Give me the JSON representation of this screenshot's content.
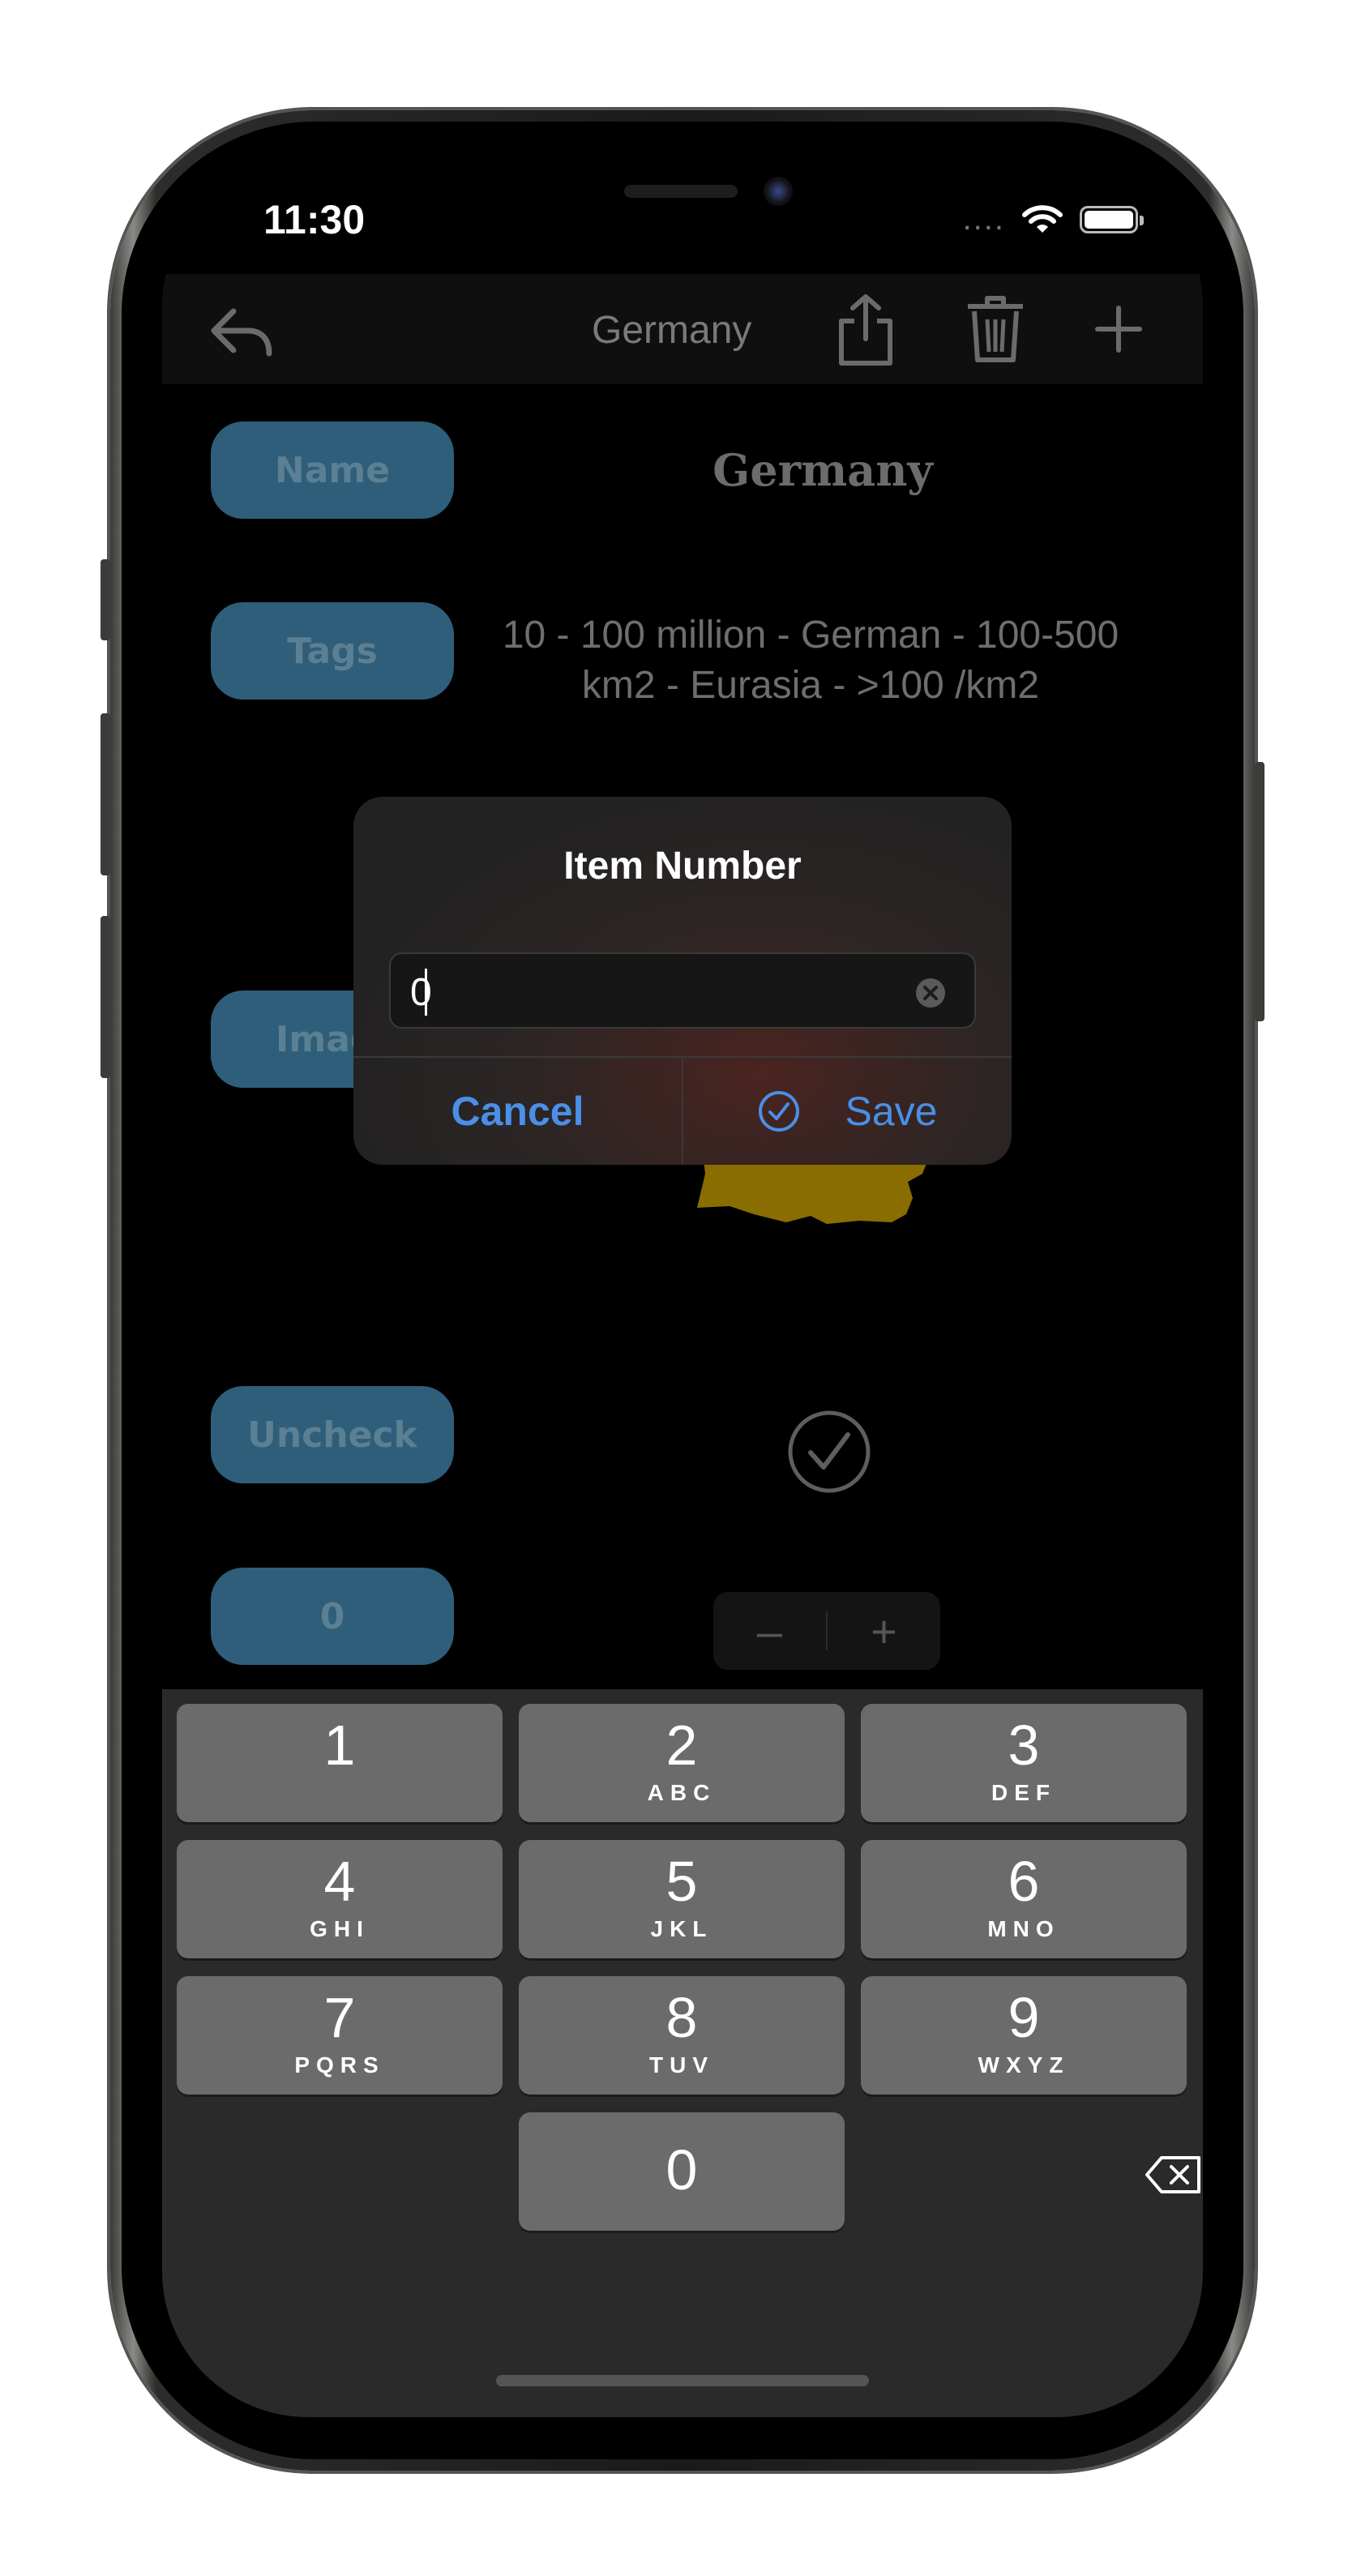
{
  "status_bar": {
    "time": "11:30",
    "signal": "...."
  },
  "nav": {
    "title": "Germany"
  },
  "fields": {
    "name_label": "Name",
    "name_value": "Germany",
    "tags_label": "Tags",
    "tags_value_line1": "10 - 100 million - German - 100-500",
    "tags_value_line2": "km2 - Eurasia - >100 /km2",
    "image_label": "Imag",
    "uncheck_label": "Uncheck",
    "count_label": "0",
    "stepper_minus": "–",
    "stepper_plus": "+"
  },
  "alert": {
    "title": "Item Number",
    "input_value": "0",
    "cancel_label": "Cancel",
    "save_label": "Save"
  },
  "keypad": [
    {
      "num": "1",
      "letters": ""
    },
    {
      "num": "2",
      "letters": "ABC"
    },
    {
      "num": "3",
      "letters": "DEF"
    },
    {
      "num": "4",
      "letters": "GHI"
    },
    {
      "num": "5",
      "letters": "JKL"
    },
    {
      "num": "6",
      "letters": "MNO"
    },
    {
      "num": "7",
      "letters": "PQRS"
    },
    {
      "num": "8",
      "letters": "TUV"
    },
    {
      "num": "9",
      "letters": "WXYZ"
    },
    {
      "num": "0",
      "letters": ""
    }
  ],
  "colors": {
    "accent_blue": "#4a8fe8",
    "pill_blue": "#2f5e7a",
    "map_fill": "#8a6d00"
  }
}
